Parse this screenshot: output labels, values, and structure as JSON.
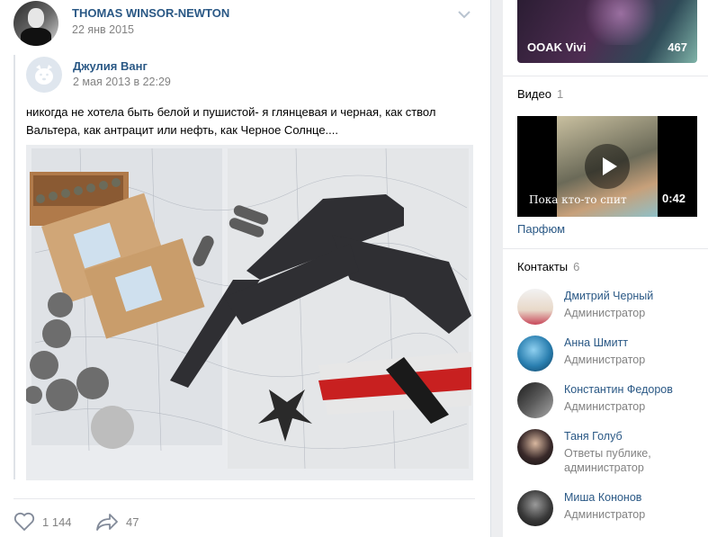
{
  "post": {
    "author": "THOMAS WINSOR-NEWTON",
    "date": "22 янв 2015",
    "repost": {
      "author": "Джулия Ванг",
      "date": "2 мая 2013 в 22:29",
      "text": "никогда не хотела быть белой и пушистой- я глянцевая и черная, как ствол Вальтера, как антрацит или нефть, как Черное Солнце...."
    },
    "likes": "1 144",
    "shares": "47"
  },
  "sidebar": {
    "album": {
      "title": "OOAK Vivi",
      "count": "467"
    },
    "videos": {
      "heading": "Видео",
      "count": "1",
      "items": [
        {
          "caption": "Пока кто-то спит",
          "duration": "0:42",
          "title": "Парфюм"
        }
      ]
    },
    "contacts": {
      "heading": "Контакты",
      "count": "6",
      "items": [
        {
          "name": "Дмитрий Черный",
          "role": "Администратор"
        },
        {
          "name": "Анна Шмитт",
          "role": "Администратор"
        },
        {
          "name": "Константин Федоров",
          "role": "Администратор"
        },
        {
          "name": "Таня Голуб",
          "role": "Ответы публике, администратор"
        },
        {
          "name": "Миша Кононов",
          "role": "Администратор"
        }
      ]
    }
  },
  "colors": {
    "link": "#2a5885",
    "muted": "#828282",
    "background": "#edeef0"
  },
  "icons": {
    "like": "heart-icon",
    "share": "share-arrow-icon",
    "menu": "chevron-down-icon",
    "play": "play-icon"
  }
}
